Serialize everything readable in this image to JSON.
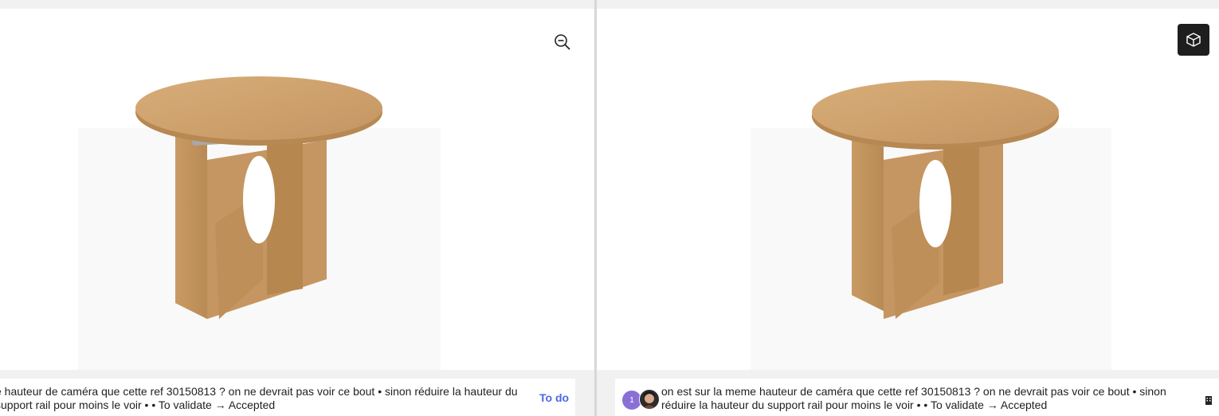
{
  "left_pane": {
    "comment": "e hauteur de caméra que cette ref 30150813 ? on ne devrait pas voir ce bout • sinon réduire la hauteur du support rail pour moins le voir • • To validate → Accepted",
    "status": "To do"
  },
  "right_pane": {
    "avatar_count": "1",
    "comment": "on est sur la meme hauteur de caméra que cette ref 30150813 ? on ne devrait pas voir ce bout • sinon réduire la hauteur du support rail pour moins le voir • • To validate → Accepted"
  },
  "icons": {
    "zoom": "zoom-out-icon",
    "view3d": "cube-icon",
    "building": "building-icon"
  },
  "colors": {
    "status_link": "#4a68e8",
    "avatar_bg": "#8a6fd6",
    "view3d_bg": "#1e1e1e",
    "wood": "#c99a63"
  }
}
